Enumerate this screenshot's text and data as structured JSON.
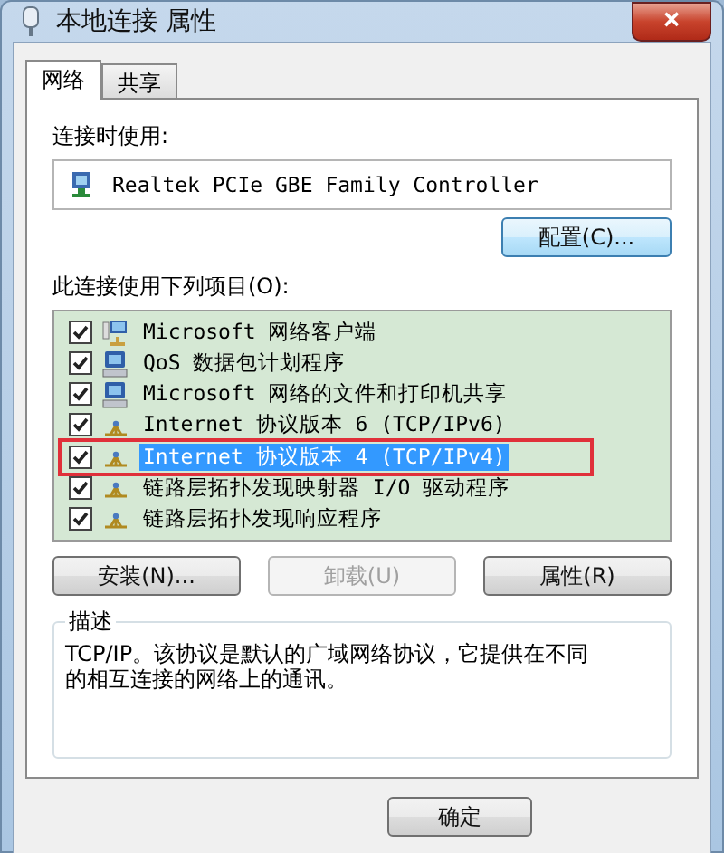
{
  "window": {
    "title": "本地连接 属性",
    "close": "×"
  },
  "tabs": [
    {
      "label": "网络",
      "selected": true
    },
    {
      "label": "共享",
      "selected": false
    }
  ],
  "connect_using": {
    "label": "连接时使用:",
    "adapter": "Realtek PCIe GBE Family Controller",
    "configure_button": "配置(C)..."
  },
  "items_label": "此连接使用下列项目(O):",
  "items": [
    {
      "label": "Microsoft 网络客户端",
      "checked": true,
      "selected": false,
      "outlined": false,
      "kind": "client"
    },
    {
      "label": "QoS 数据包计划程序",
      "checked": true,
      "selected": false,
      "outlined": false,
      "kind": "service"
    },
    {
      "label": "Microsoft 网络的文件和打印机共享",
      "checked": true,
      "selected": false,
      "outlined": false,
      "kind": "service"
    },
    {
      "label": "Internet 协议版本 6 (TCP/IPv6)",
      "checked": true,
      "selected": false,
      "outlined": false,
      "kind": "protocol"
    },
    {
      "label": "Internet 协议版本 4 (TCP/IPv4)",
      "checked": true,
      "selected": true,
      "outlined": true,
      "kind": "protocol"
    },
    {
      "label": "链路层拓扑发现映射器 I/O 驱动程序",
      "checked": true,
      "selected": false,
      "outlined": false,
      "kind": "protocol"
    },
    {
      "label": "链路层拓扑发现响应程序",
      "checked": true,
      "selected": false,
      "outlined": false,
      "kind": "protocol"
    }
  ],
  "item_buttons": [
    {
      "label": "安装(N)...",
      "disabled": false
    },
    {
      "label": "卸载(U)",
      "disabled": true
    },
    {
      "label": "属性(R)",
      "disabled": false
    }
  ],
  "description": {
    "title": "描述",
    "text": "TCP/IP。该协议是默认的广域网络协议，它提供在不同的相互连接的网络上的通讯。"
  },
  "dialog_buttons": [
    {
      "label": "确定"
    }
  ]
}
